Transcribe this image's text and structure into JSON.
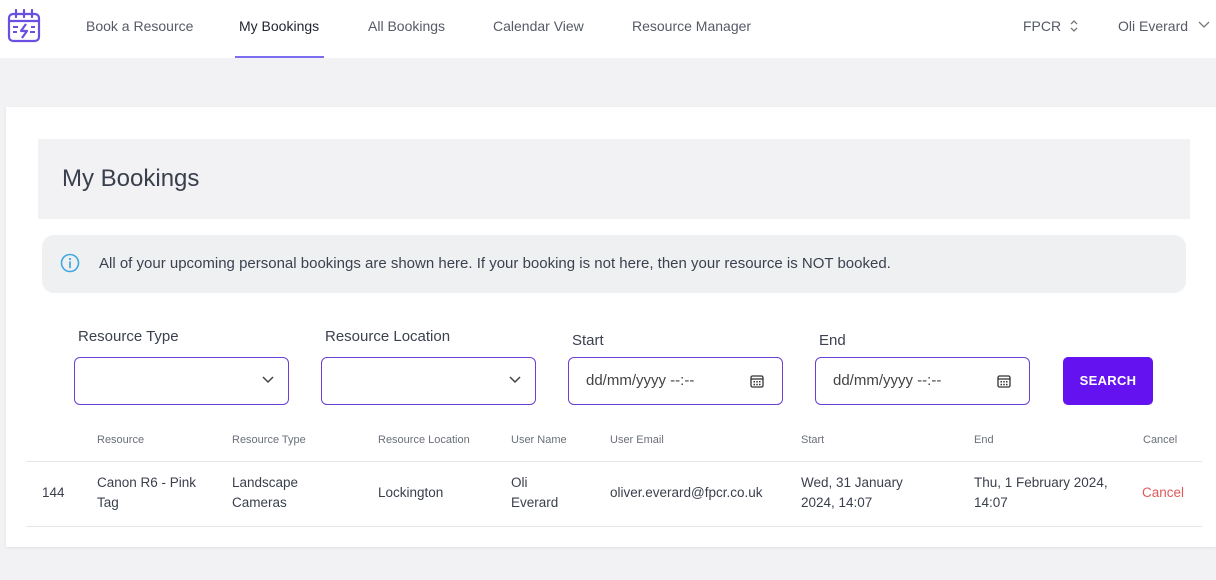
{
  "nav": {
    "items": [
      {
        "label": "Book a Resource"
      },
      {
        "label": "My Bookings"
      },
      {
        "label": "All Bookings"
      },
      {
        "label": "Calendar View"
      },
      {
        "label": "Resource Manager"
      }
    ],
    "org": "FPCR",
    "user": "Oli Everard"
  },
  "page": {
    "title": "My Bookings",
    "info": "All of your upcoming personal bookings are shown here. If your booking is not here, then your resource is NOT booked."
  },
  "filters": {
    "resource_type_label": "Resource Type",
    "resource_location_label": "Resource Location",
    "start_label": "Start",
    "end_label": "End",
    "start_placeholder": "dd/mm/yyyy --:--",
    "end_placeholder": "dd/mm/yyyy --:--",
    "search_label": "SEARCH"
  },
  "table": {
    "headers": {
      "resource": "Resource",
      "resource_type": "Resource Type",
      "resource_location": "Resource Location",
      "user_name": "User Name",
      "user_email": "User Email",
      "start": "Start",
      "end": "End",
      "cancel": "Cancel"
    },
    "rows": [
      {
        "id": "144",
        "resource": "Canon R6 - Pink Tag",
        "resource_type": "Landscape Cameras",
        "resource_location": "Lockington",
        "user_name": "Oli Everard",
        "user_email": "oliver.everard@fpcr.co.uk",
        "start": "Wed, 31 January 2024, 14:07",
        "end": "Thu, 1 February 2024, 14:07",
        "cancel": "Cancel"
      }
    ]
  },
  "colors": {
    "accent": "#6413f0",
    "input_border": "#6a3fd6",
    "cancel": "#e05a5a",
    "info_icon": "#3fa8e0"
  },
  "icons": [
    "calendar-bolt-logo-icon",
    "up-down-chevron-icon",
    "chevron-down-icon",
    "info-icon",
    "calendar-icon"
  ]
}
